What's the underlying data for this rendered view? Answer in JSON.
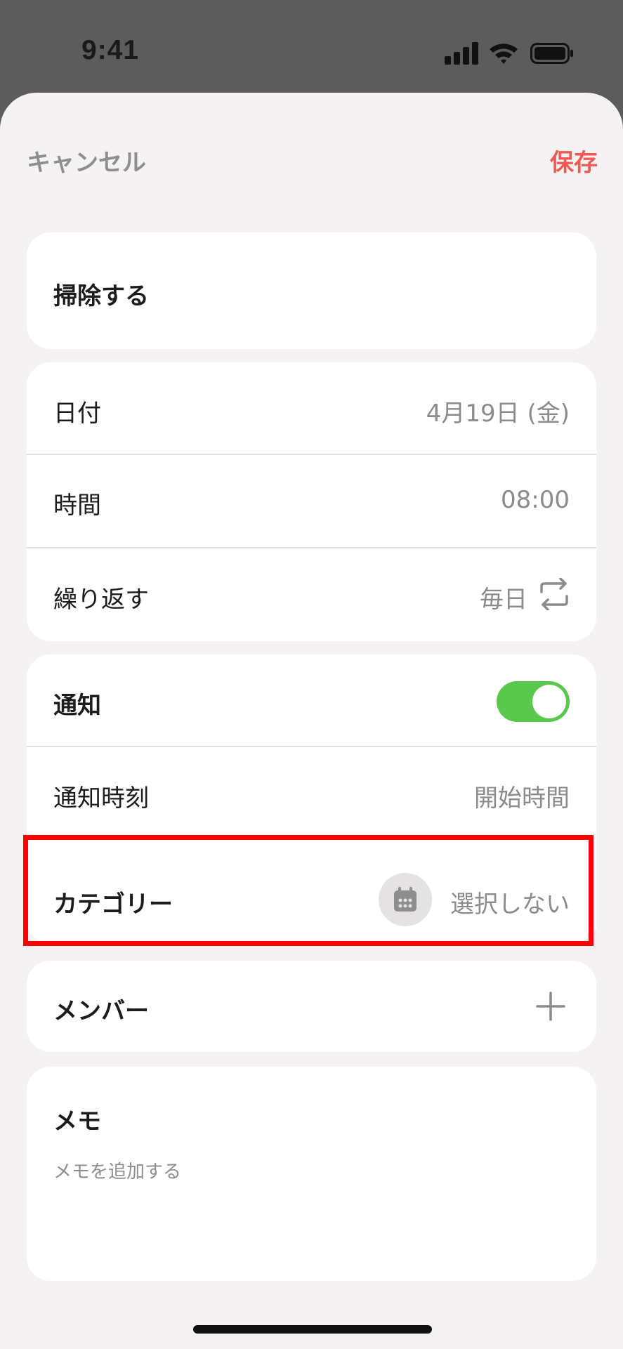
{
  "status_bar": {
    "time": "9:41",
    "icons": [
      "cellular-signal-icon",
      "wifi-icon",
      "battery-icon"
    ]
  },
  "nav": {
    "cancel_label": "キャンセル",
    "save_label": "保存"
  },
  "task": {
    "title": "掃除する"
  },
  "schedule": {
    "date_label": "日付",
    "date_value": "4月19日 (金)",
    "time_label": "時間",
    "time_value": "08:00",
    "repeat_label": "繰り返す",
    "repeat_value": "毎日",
    "repeat_icon": "repeat-icon"
  },
  "notification": {
    "label": "通知",
    "enabled": true,
    "timing_label": "通知時刻",
    "timing_value": "開始時間"
  },
  "category": {
    "label": "カテゴリー",
    "value": "選択しない",
    "icon": "calendar-icon"
  },
  "members": {
    "label": "メンバー",
    "icon": "plus-icon"
  },
  "memo": {
    "label": "メモ",
    "placeholder": "メモを追加する"
  },
  "colors": {
    "accent_red": "#ef5a52",
    "toggle_green": "#5ac84c",
    "highlight_red": "#ff0000",
    "sheet_bg": "#f4f2f3",
    "backdrop": "#5c5c5c"
  }
}
